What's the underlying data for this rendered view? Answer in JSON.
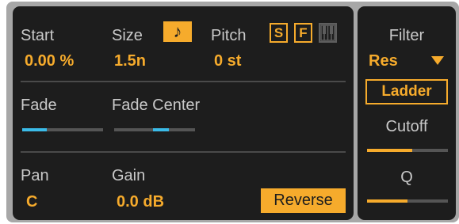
{
  "sample": {
    "start": {
      "label": "Start",
      "value": "0.00 %"
    },
    "size": {
      "label": "Size",
      "value": "1.5n",
      "note_icon": "♪"
    },
    "pitch": {
      "label": "Pitch",
      "value": "0 st"
    },
    "toggles": {
      "s_label": "S",
      "f_label": "F",
      "keys_icon": "piano-keys-icon"
    },
    "fade": {
      "label": "Fade",
      "level": 0.3
    },
    "fade_center": {
      "label": "Fade Center",
      "level": 0.5
    },
    "pan": {
      "label": "Pan",
      "value": "C"
    },
    "gain": {
      "label": "Gain",
      "value": "0.0 dB"
    },
    "reverse_label": "Reverse"
  },
  "filter": {
    "title": "Filter",
    "type_value": "Res",
    "ladder_label": "Ladder",
    "cutoff": {
      "label": "Cutoff",
      "level": 0.56
    },
    "q": {
      "label": "Q",
      "level": 0.5
    }
  },
  "colors": {
    "accent": "#f6ab2c",
    "slider_blue": "#3bbbe8",
    "panel": "#1d1d1d",
    "text": "#c9c9c9"
  }
}
